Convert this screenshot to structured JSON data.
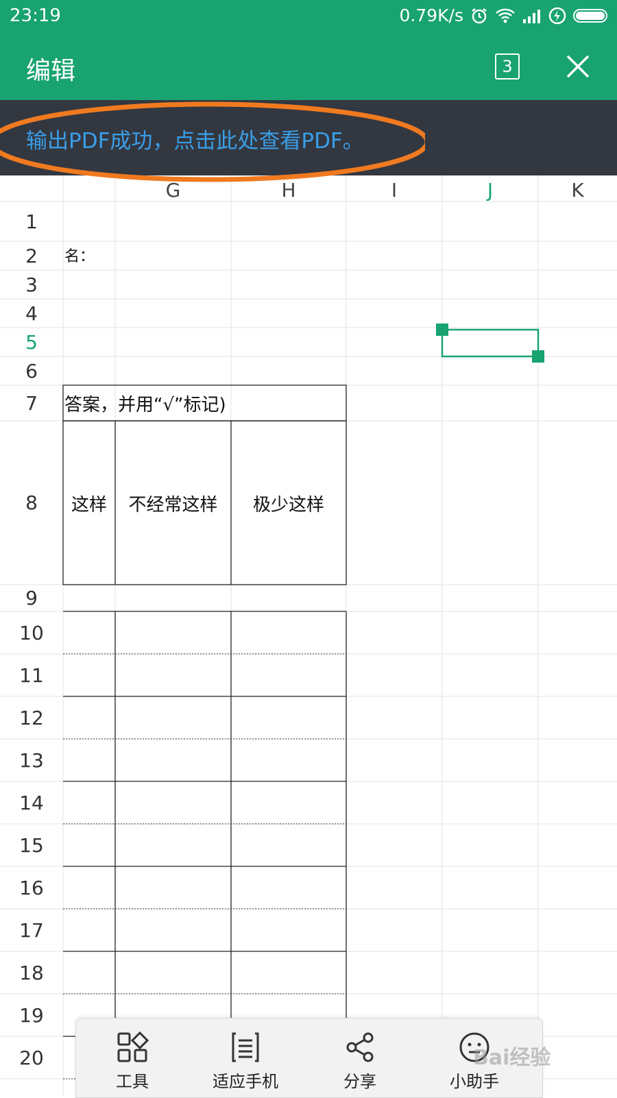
{
  "status_bar": {
    "time": "23:19",
    "speed": "0.79K/s"
  },
  "app_bar": {
    "title": "编辑",
    "tab_count": "3"
  },
  "banner": {
    "text": "输出PDF成功，点击此处查看PDF。"
  },
  "sheet": {
    "columns": [
      "G",
      "H",
      "I",
      "J",
      "K"
    ],
    "active_column": "J",
    "active_row": "5",
    "rows": [
      "1",
      "2",
      "3",
      "4",
      "5",
      "6",
      "7",
      "8",
      "9",
      "10",
      "11",
      "12",
      "13",
      "14",
      "15",
      "16",
      "17",
      "18",
      "19",
      "20"
    ],
    "cells": {
      "r2": "名：",
      "r7": "答案，并用“√”标记)",
      "r8_f": "这样",
      "r8_g": "不经常这样",
      "r8_h": "极少这样"
    }
  },
  "toolbar": {
    "items": [
      {
        "label": "工具",
        "icon": "grid-shapes-icon"
      },
      {
        "label": "适应手机",
        "icon": "fit-phone-icon"
      },
      {
        "label": "分享",
        "icon": "share-icon"
      },
      {
        "label": "小助手",
        "icon": "assistant-face-icon"
      }
    ]
  },
  "watermark": "Bai经验",
  "colors": {
    "brand": "#18a371",
    "banner_bg": "#333740",
    "banner_text": "#3a9ee8",
    "annotation": "#f07a20"
  }
}
